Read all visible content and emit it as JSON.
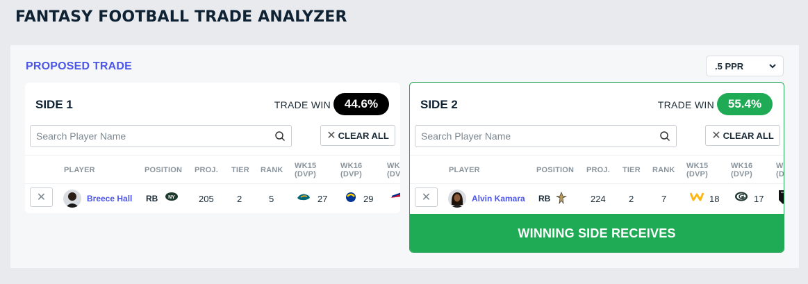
{
  "app": {
    "title": "FANTASY FOOTBALL TRADE ANALYZER"
  },
  "trade": {
    "heading": "PROPOSED TRADE",
    "scoring": "​.5 PPR"
  },
  "columns": {
    "player": "PLAYER",
    "position": "POSITION",
    "proj": "PROJ.",
    "tier": "TIER",
    "rank": "RANK",
    "wk15_a": "WK15",
    "wk15_b": "(DVP)",
    "wk16_a": "WK16",
    "wk16_b": "(DVP)",
    "wk17_a": "WK",
    "wk17_b": "(DV"
  },
  "side1": {
    "title": "SIDE 1",
    "trade_win_label": "TRADE WIN",
    "trade_win_pct": "44.6%",
    "search_placeholder": "Search Player Name",
    "clear_all": "CLEAR ALL",
    "remove": "✕",
    "player": {
      "name": "Breece Hall",
      "position": "RB",
      "team_icon": "jets-logo-icon",
      "proj": "205",
      "tier": "2",
      "rank": "5",
      "wk15_opp_icon": "jaguars-logo-icon",
      "wk15_dvp": "27",
      "wk16_opp_icon": "rams-logo-icon",
      "wk16_dvp": "29",
      "wk17_opp_icon": "bills-logo-icon"
    }
  },
  "side2": {
    "title": "SIDE 2",
    "trade_win_label": "TRADE WIN",
    "trade_win_pct": "55.4%",
    "search_placeholder": "Search Player Name",
    "clear_all": "CLEAR ALL",
    "remove": "✕",
    "winning_label": "WINNING SIDE RECEIVES",
    "player": {
      "name": "Alvin Kamara",
      "position": "RB",
      "team_icon": "saints-logo-icon",
      "proj": "224",
      "tier": "2",
      "rank": "7",
      "wk15_opp_icon": "commanders-logo-icon",
      "wk15_dvp": "18",
      "wk16_opp_icon": "packers-logo-icon",
      "wk16_dvp": "17",
      "wk17_opp_icon": "raiders-logo-icon"
    }
  },
  "colors": {
    "accent": "#4b55e6",
    "win_green": "#1fab55",
    "loss_black": "#000000"
  }
}
